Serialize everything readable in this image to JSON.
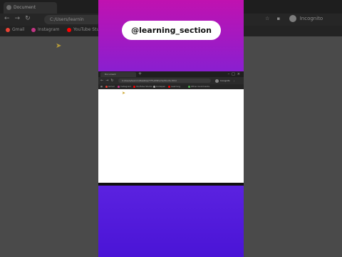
{
  "background_browser": {
    "tab_title": "Document",
    "url": "C:/Users/learnin",
    "bookmarks": [
      {
        "label": "Gmail",
        "color": "#ea4335"
      },
      {
        "label": "Instagram",
        "color": "#c13584"
      },
      {
        "label": "YouTube Stu",
        "color": "#ff0000"
      }
    ],
    "profile_label": "Incognito"
  },
  "video": {
    "handle": "@learning_section"
  },
  "mini_browser": {
    "tab_title": "Document",
    "url": "C:/Users/learnin/Desktop/YT%20Shorts/Shorts.html",
    "profile_label": "Incognito",
    "bookmarks": [
      {
        "label": "Gmail",
        "color": "#ea4335"
      },
      {
        "label": "Instagram",
        "color": "#c13584"
      },
      {
        "label": "YouTube Studio",
        "color": "#ff0000"
      },
      {
        "label": "Codepen",
        "color": "#aaaaaa"
      },
      {
        "label": "Learning",
        "color": "#ff0000"
      },
      {
        "label": "Other bookmarks",
        "color": "#4caf50"
      }
    ]
  },
  "colors": {
    "grad_top_start": "#c012b0",
    "grad_top_end": "#8a1fd0",
    "grad_bottom": "#4a14d6"
  }
}
